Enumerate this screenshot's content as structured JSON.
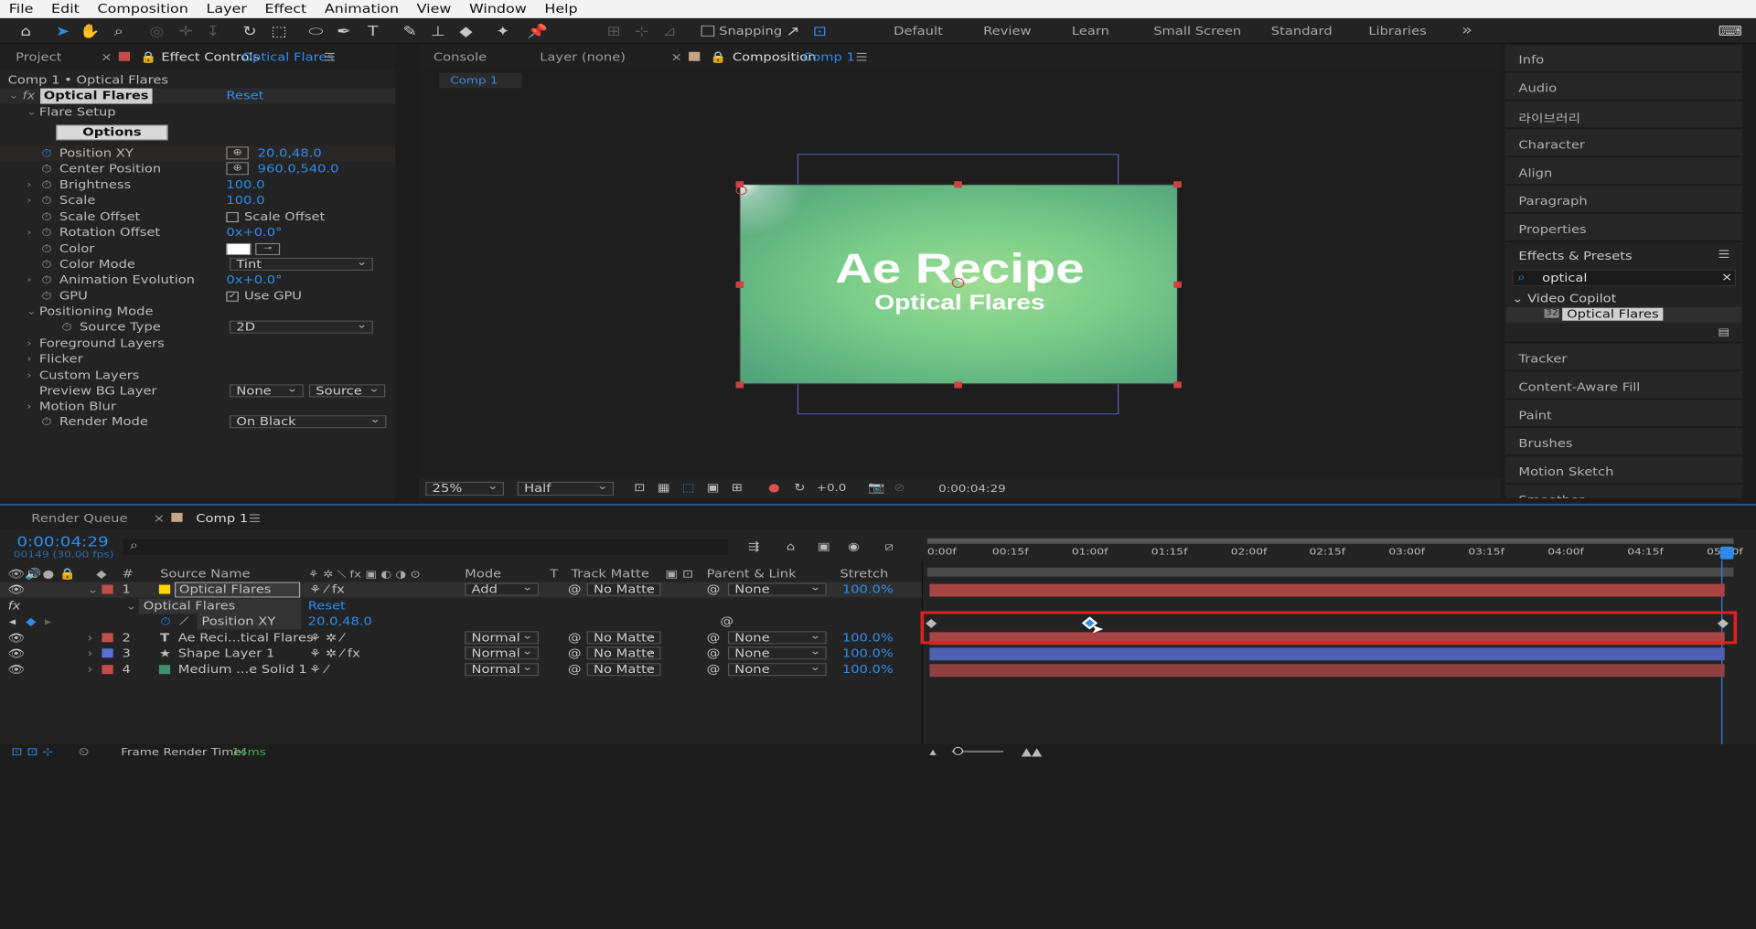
{
  "menu": [
    "File",
    "Edit",
    "Composition",
    "Layer",
    "Effect",
    "Animation",
    "View",
    "Window",
    "Help"
  ],
  "toolbar": {
    "snapping": "Snapping",
    "workspaces": [
      "Default",
      "Review",
      "Learn",
      "Small Screen",
      "Standard",
      "Libraries"
    ],
    "more": "»"
  },
  "left_panel": {
    "tab_project": "Project",
    "tab_effect_controls": "Effect Controls",
    "tab_effect_name": "Optical Flares",
    "breadcrumb": "Comp 1 • Optical Flares",
    "effect_name": "Optical Flares",
    "reset": "Reset",
    "flare_setup": "Flare Setup",
    "options": "Options",
    "props": [
      {
        "label": "Position XY",
        "value": "20.0,48.0"
      },
      {
        "label": "Center Position",
        "value": "960.0,540.0"
      },
      {
        "label": "Brightness",
        "value": "100.0"
      },
      {
        "label": "Scale",
        "value": "100.0"
      },
      {
        "label": "Scale Offset",
        "value": "Scale Offset"
      },
      {
        "label": "Rotation Offset",
        "value": "0x+0.0°"
      },
      {
        "label": "Color",
        "value": ""
      },
      {
        "label": "Color Mode",
        "value": "Tint"
      },
      {
        "label": "Animation Evolution",
        "value": "0x+0.0°"
      },
      {
        "label": "GPU",
        "value": "Use GPU"
      },
      {
        "label": "Positioning Mode",
        "value": ""
      },
      {
        "label": "Source Type",
        "value": "2D"
      },
      {
        "label": "Foreground Layers",
        "value": ""
      },
      {
        "label": "Flicker",
        "value": ""
      },
      {
        "label": "Custom Layers",
        "value": ""
      },
      {
        "label": "Preview BG Layer",
        "value": "None",
        "value2": "Source"
      },
      {
        "label": "Motion Blur",
        "value": ""
      },
      {
        "label": "Render Mode",
        "value": "On Black"
      }
    ]
  },
  "center": {
    "tab_console": "Console",
    "tab_layer": "Layer (none)",
    "tab_composition": "Composition",
    "comp_name": "Comp 1",
    "subtab": "Comp 1",
    "title": "Ae Recipe",
    "subtitle": "Optical Flares",
    "zoom": "25%",
    "resolution": "Half",
    "exposure": "+0.0",
    "timecode": "0:00:04:29"
  },
  "right": {
    "items_top": [
      "Info",
      "Audio",
      "라이브러리",
      "Character",
      "Align",
      "Paragraph",
      "Properties"
    ],
    "effects_presets": "Effects & Presets",
    "search": "optical",
    "group": "Video Copilot",
    "effect": "Optical Flares",
    "items_bottom": [
      "Tracker",
      "Content-Aware Fill",
      "Paint",
      "Brushes",
      "Motion Sketch",
      "Smoother"
    ]
  },
  "timeline": {
    "tab_render": "Render Queue",
    "tab_comp": "Comp 1",
    "timecode": "0:00:04:29",
    "frames": "00149 (30.00 fps)",
    "headers": {
      "num": "#",
      "source": "Source Name",
      "mode": "Mode",
      "t": "T",
      "track": "Track Matte",
      "parent": "Parent & Link",
      "stretch": "Stretch"
    },
    "ruler": [
      "0:00f",
      "00:15f",
      "01:00f",
      "01:15f",
      "02:00f",
      "02:15f",
      "03:00f",
      "03:15f",
      "04:00f",
      "04:15f",
      "05:00f"
    ],
    "layers": [
      {
        "num": "1",
        "name": "Optical Flares",
        "mode": "Add",
        "matte": "No Matte",
        "parent": "None",
        "stretch": "100.0%",
        "color": "#c44c4c"
      },
      {
        "num": "2",
        "name": "Ae Reci...tical Flares",
        "mode": "Normal",
        "matte": "No Matte",
        "parent": "None",
        "stretch": "100.0%",
        "color": "#c44c4c"
      },
      {
        "num": "3",
        "name": "Shape Layer 1",
        "mode": "Normal",
        "matte": "No Matte",
        "parent": "None",
        "stretch": "100.0%",
        "color": "#5a6fd6"
      },
      {
        "num": "4",
        "name": "Medium ...e Solid 1",
        "mode": "Normal",
        "matte": "No Matte",
        "parent": "None",
        "stretch": "100.0%",
        "color": "#c44c4c"
      }
    ],
    "effect_row": "Optical Flares",
    "effect_reset": "Reset",
    "prop_name": "Position XY",
    "prop_value": "20.0,48.0",
    "render_time_label": "Frame Render Time:",
    "render_time": "14ms"
  }
}
